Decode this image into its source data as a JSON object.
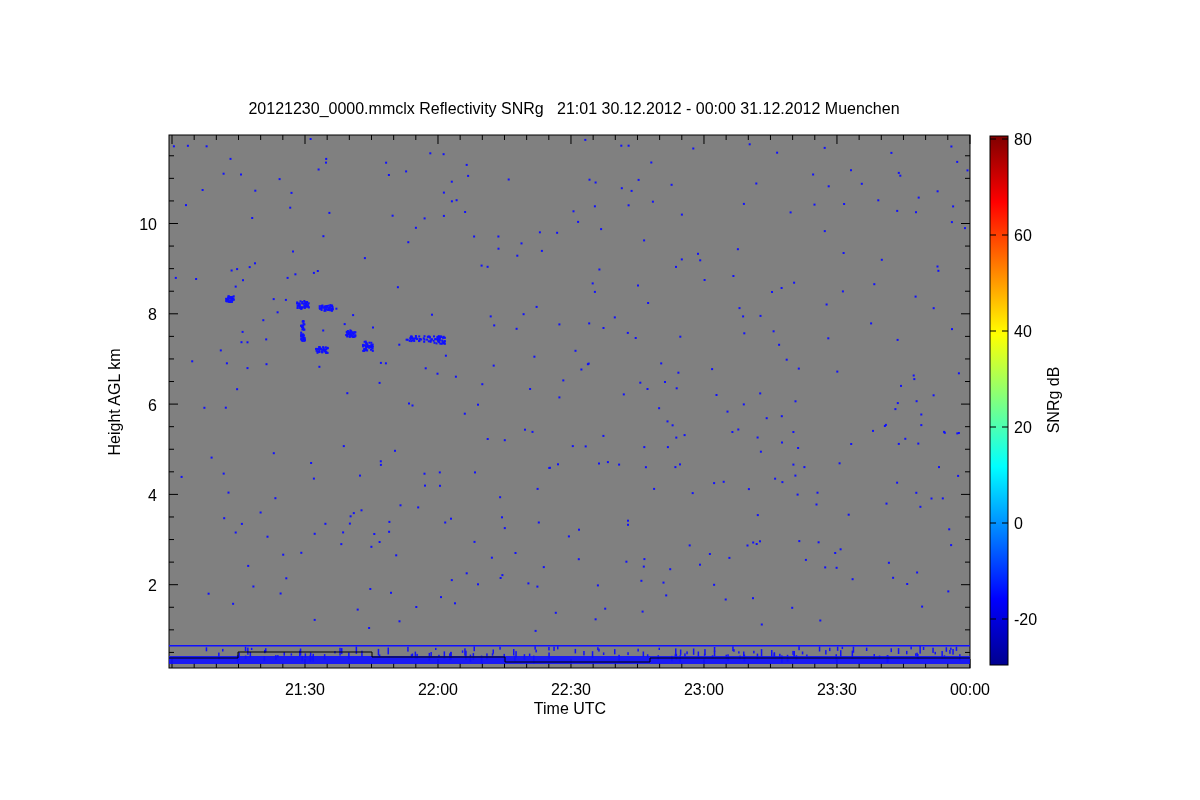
{
  "title": "20121230_0000.mmclx Reflectivity SNRg   21:01 30.12.2012 - 00:00 31.12.2012 Muenchen",
  "plot": {
    "ylabel": "Height AGL km",
    "xlabel": "Time UTC",
    "yticks": [
      "10",
      "8",
      "6",
      "4",
      "2"
    ],
    "xticks": [
      "21:30",
      "22:00",
      "22:30",
      "23:00",
      "23:30",
      "00:00"
    ]
  },
  "colorbar": {
    "label": "SNRg dB",
    "ticks": [
      "80",
      "60",
      "40",
      "20",
      "0",
      "-20"
    ]
  }
}
